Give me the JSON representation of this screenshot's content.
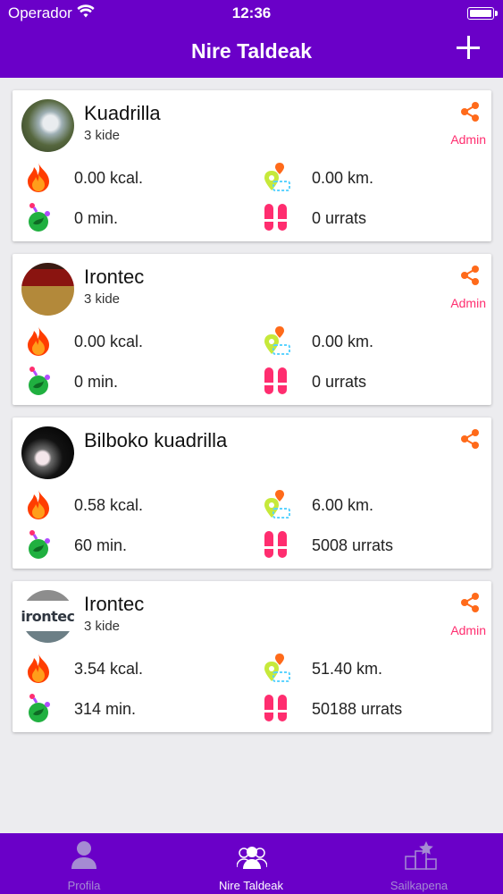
{
  "status_bar": {
    "carrier": "Operador",
    "time": "12:36"
  },
  "nav": {
    "title": "Nire Taldeak",
    "add_icon": "plus-icon"
  },
  "groups": [
    {
      "name": "Kuadrilla",
      "members": "3 kide",
      "badge": "Admin",
      "kcal": "0.00 kcal.",
      "km": "0.00 km.",
      "minutes": "0 min.",
      "steps": "0 urrats"
    },
    {
      "name": "Irontec",
      "members": "3 kide",
      "badge": "Admin",
      "kcal": "0.00 kcal.",
      "km": "0.00 km.",
      "minutes": "0 min.",
      "steps": "0 urrats"
    },
    {
      "name": "Bilboko kuadrilla",
      "members": "",
      "badge": "",
      "kcal": "0.58 kcal.",
      "km": "6.00 km.",
      "minutes": "60 min.",
      "steps": "5008 urrats"
    },
    {
      "name": "Irontec",
      "members": "3 kide",
      "badge": "Admin",
      "kcal": "3.54 kcal.",
      "km": "51.40 km.",
      "minutes": "314 min.",
      "steps": "50188 urrats",
      "avatar_text": "irontec"
    }
  ],
  "tabs": [
    {
      "label": "Profila",
      "icon": "person-icon"
    },
    {
      "label": "Nire Taldeak",
      "icon": "group-icon"
    },
    {
      "label": "Sailkapena",
      "icon": "podium-star-icon"
    }
  ],
  "colors": {
    "brand": "#6a00c8",
    "admin": "#ff2d6f",
    "share": "#ff6a1a",
    "steps": "#ff2d6f",
    "minutes": "#20b040"
  }
}
